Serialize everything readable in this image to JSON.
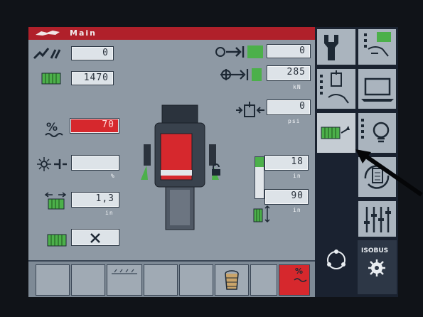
{
  "header": {
    "title": "Main"
  },
  "fields": {
    "row1_value": "0",
    "row2_value": "1470",
    "percent_value": "70",
    "dim_value": "",
    "width_value": "1,3",
    "width_unit": "in",
    "hydraulic_value": "",
    "dim_unit": "%"
  },
  "right_fields": {
    "top_value": "0",
    "force_value": "285",
    "force_unit": "kN",
    "pressure_value": "0",
    "pressure_unit": "psi",
    "height1_value": "18",
    "height1_unit": "in",
    "height2_value": "90",
    "height2_unit": "in"
  },
  "bottom": {
    "percent_symbol": "%"
  },
  "isobus": {
    "label": "ISOBUS"
  },
  "colors": {
    "red": "#d6282d",
    "green": "#4cb04a",
    "panel": "#8e99a4"
  },
  "icons": [
    "wrench-icon",
    "hand-settings-icon",
    "bucket-hand-icon",
    "laptop-icon",
    "device-arrow-icon",
    "bulb-icon",
    "rotate-clipboard-icon",
    "slider-icon",
    "share-network-icon",
    "isobus-gear-icon",
    "basket-icon"
  ]
}
